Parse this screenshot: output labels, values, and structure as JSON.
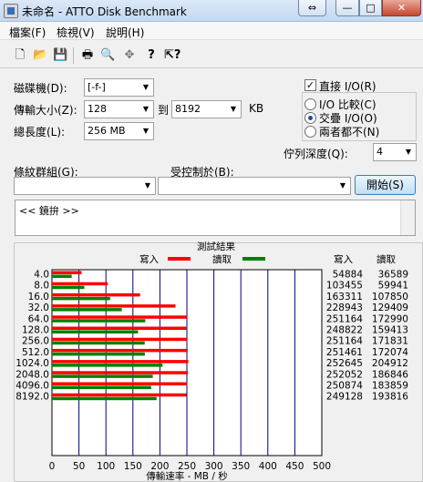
{
  "window": {
    "title": "未命名 - ATTO Disk Benchmark",
    "controls": {
      "swap": "⇔",
      "minimize": "—",
      "maximize": "□",
      "close": "✕"
    }
  },
  "menu": [
    {
      "label": "檔案(F)"
    },
    {
      "label": "檢視(V)"
    },
    {
      "label": "說明(H)"
    }
  ],
  "toolbar": {
    "icons": [
      "new-icon",
      "open-icon",
      "save-icon",
      "print-icon",
      "print-preview-icon",
      "move-icon",
      "help-icon",
      "context-help-icon"
    ]
  },
  "form": {
    "drive_label": "磁碟機(D):",
    "drive_value": "[-f-]",
    "transfer_label": "傳輸大小(Z):",
    "transfer_from": "128",
    "to_label": "到",
    "transfer_to": "8192",
    "kb_label": "KB",
    "length_label": "總長度(L):",
    "length_value": "256 MB",
    "direct_io_label": "直接 I/O(R)",
    "direct_io_checked": true,
    "io_compare_label": "I/O 比較(C)",
    "overlapped_io_label": "交疊 I/O(O)",
    "neither_label": "兩者都不(N)",
    "io_mode_selected": "overlapped",
    "queue_label": "佇列深度(Q):",
    "queue_value": "4",
    "controller_label": "條紋群組(G):",
    "controlled_by_label": "受控制於(B):",
    "start_button": "開始(S)",
    "description": "<< 鏡拚 >>"
  },
  "chart_data": {
    "type": "bar",
    "title": "測試結果",
    "xlabel": "傳輸速率 - MB / 秒",
    "xlim": [
      0,
      500
    ],
    "xticks": [
      "0",
      "50",
      "100",
      "150",
      "200",
      "250",
      "300",
      "350",
      "400",
      "450",
      "500"
    ],
    "legend_placement": "top",
    "write_column_header": "寫入",
    "read_column_header": "讀取",
    "categories": [
      "4.0",
      "8.0",
      "16.0",
      "32.0",
      "64.0",
      "128.0",
      "256.0",
      "512.0",
      "1024.0",
      "2048.0",
      "4096.0",
      "8192.0"
    ],
    "series": [
      {
        "name": "寫入",
        "color": "#ff0000",
        "values": [
          54884,
          103455,
          163311,
          228943,
          251164,
          248822,
          251164,
          251461,
          252645,
          252052,
          250874,
          249128
        ]
      },
      {
        "name": "讀取",
        "color": "#008000",
        "values": [
          36589,
          59941,
          107850,
          129409,
          172990,
          159413,
          171831,
          172074,
          204912,
          186846,
          183859,
          193816
        ]
      }
    ],
    "value_unit_divisor": 1000,
    "grid": true,
    "plot_background": "#ffffff",
    "grid_color": "#000080"
  }
}
